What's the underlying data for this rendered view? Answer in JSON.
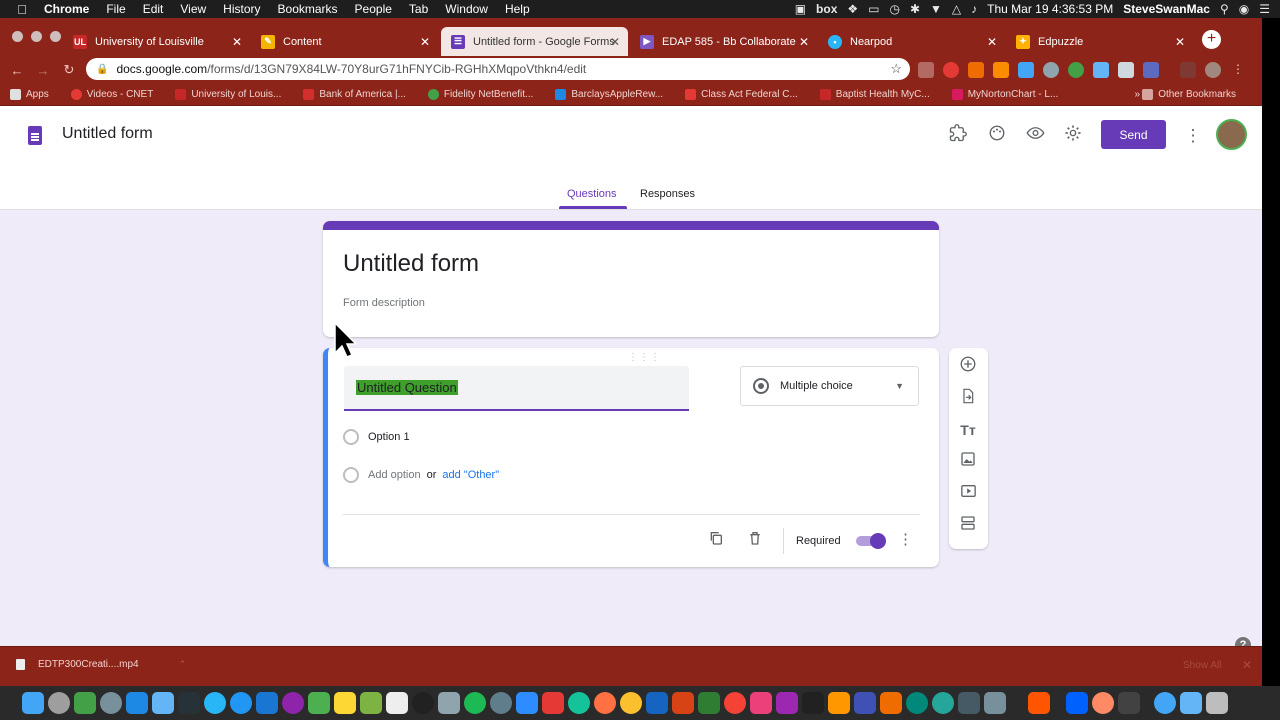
{
  "menubar": {
    "app_name": "Chrome",
    "items": [
      "File",
      "Edit",
      "View",
      "History",
      "Bookmarks",
      "People",
      "Tab",
      "Window",
      "Help"
    ],
    "box_label": "box",
    "datetime": "Thu Mar 19  4:36:53 PM",
    "username": "SteveSwanMac"
  },
  "browser": {
    "tabs": [
      {
        "title": "University of Louisville",
        "favicon": "UL",
        "color": "#c62828"
      },
      {
        "title": "Content",
        "favicon": "",
        "color": "#f4b400"
      },
      {
        "title": "Untitled form - Google Forms",
        "favicon": "",
        "color": "#673ab7"
      },
      {
        "title": "EDAP 585 - Bb Collaborate",
        "favicon": "",
        "color": "#7e57c2"
      },
      {
        "title": "Nearpod",
        "favicon": "",
        "color": "#29b6f6"
      },
      {
        "title": "Edpuzzle",
        "favicon": "",
        "color": "#ffb300"
      }
    ],
    "url_host": "docs.google.com",
    "url_path": "/forms/d/13GN79X84LW-70Y8urG71hFNYCib-RGHhXMqpoVthkn4/edit",
    "bookmarks": [
      {
        "label": "Apps",
        "color": "#e0e0e0"
      },
      {
        "label": "Videos - CNET",
        "color": "#e53935"
      },
      {
        "label": "University of Louis...",
        "color": "#c62828"
      },
      {
        "label": "Bank of America |...",
        "color": "#d32f2f"
      },
      {
        "label": "Fidelity NetBenefit...",
        "color": "#43a047"
      },
      {
        "label": "BarclaysAppleRew...",
        "color": "#1e88e5"
      },
      {
        "label": "Class Act Federal C...",
        "color": "#e53935"
      },
      {
        "label": "Baptist Health MyC...",
        "color": "#c62828"
      },
      {
        "label": "MyNortonChart - L...",
        "color": "#d81b60"
      }
    ],
    "bookmarks_more": "»",
    "other_bookmarks": "Other Bookmarks"
  },
  "forms": {
    "doc_title": "Untitled form",
    "send_label": "Send",
    "tabs": {
      "questions": "Questions",
      "responses": "Responses"
    },
    "form_title": "Untitled form",
    "form_description_placeholder": "Form description",
    "question": {
      "title": "Untitled Question",
      "type": "Multiple choice",
      "options": [
        "Option 1"
      ],
      "add_option": "Add option",
      "or_text": "or",
      "add_other": "add \"Other\"",
      "required_label": "Required",
      "required": true
    },
    "accent_color": "#673ab7"
  },
  "downloads": {
    "file_name": "EDTP300Creati....mp4",
    "show_all": "Show All"
  }
}
